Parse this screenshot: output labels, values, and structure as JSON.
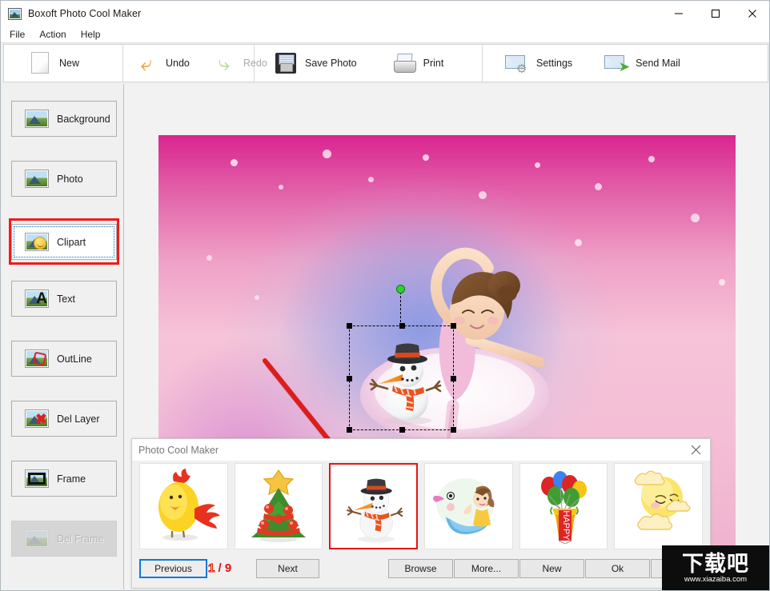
{
  "window": {
    "title": "Boxoft Photo Cool Maker",
    "icon": "app-photo-icon",
    "controls": {
      "minimize": "—",
      "maximize": "☐",
      "close": "✕"
    }
  },
  "menubar": {
    "items": [
      {
        "label": "File"
      },
      {
        "label": "Action"
      },
      {
        "label": "Help"
      }
    ]
  },
  "toolbar": {
    "groups": [
      {
        "buttons": [
          {
            "label": "New",
            "icon": "new-page-icon",
            "disabled": false
          }
        ]
      },
      {
        "buttons": [
          {
            "label": "Undo",
            "icon": "undo-arrow-icon",
            "disabled": false
          },
          {
            "label": "Redo",
            "icon": "redo-arrow-icon",
            "disabled": true
          }
        ]
      },
      {
        "buttons": [
          {
            "label": "Save Photo",
            "icon": "floppy-disk-icon",
            "disabled": false
          },
          {
            "label": "Print",
            "icon": "printer-icon",
            "disabled": false
          }
        ]
      },
      {
        "buttons": [
          {
            "label": "Settings",
            "icon": "envelope-gear-icon",
            "disabled": false
          },
          {
            "label": "Send Mail",
            "icon": "envelope-arrow-icon",
            "disabled": false
          }
        ]
      }
    ]
  },
  "sidebar": {
    "items": [
      {
        "label": "Background",
        "icon": "image-icon",
        "selected": false,
        "disabled": false
      },
      {
        "label": "Photo",
        "icon": "image-icon",
        "selected": false,
        "disabled": false
      },
      {
        "label": "Clipart",
        "icon": "image-smiley-icon",
        "selected": true,
        "disabled": false
      },
      {
        "label": "Text",
        "icon": "image-letter-a-icon",
        "selected": false,
        "disabled": false
      },
      {
        "label": "OutLine",
        "icon": "image-outline-icon",
        "selected": false,
        "disabled": false
      },
      {
        "label": "Del Layer",
        "icon": "image-delete-icon",
        "selected": false,
        "disabled": false
      },
      {
        "label": "Frame",
        "icon": "image-frame-icon",
        "selected": false,
        "disabled": false
      },
      {
        "label": "Del Frame",
        "icon": "image-del-frame-icon",
        "selected": false,
        "disabled": true
      }
    ]
  },
  "canvas": {
    "photo_description": "ballerina-winter-illustration",
    "selected_object": "snowman-clipart",
    "annotation": "red-arrow-pointing-to-dialog"
  },
  "dialog": {
    "title": "Photo Cool Maker",
    "close_label": "✕",
    "thumbnails": [
      {
        "name": "chicken-clipart",
        "selected": false
      },
      {
        "name": "christmas-tree-clipart",
        "selected": false
      },
      {
        "name": "snowman-clipart",
        "selected": true
      },
      {
        "name": "girl-on-bird-clipart",
        "selected": false
      },
      {
        "name": "happy-balloons-clipart",
        "selected": false
      },
      {
        "name": "sun-face-clouds-clipart",
        "selected": false
      }
    ],
    "balloon_banner_text": "HAPPY",
    "buttons": {
      "previous": "Previous",
      "next": "Next",
      "browse": "Browse",
      "more": "More...",
      "new": "New",
      "ok": "Ok"
    },
    "page_current": "1",
    "page_separator": "/",
    "page_total": "9"
  },
  "watermark": {
    "logo": "下载吧",
    "url": "www.xiazaiba.com"
  },
  "colors": {
    "accent_red": "#e81414",
    "focus_blue": "#0a7ad6",
    "page_number_yellow": "#ffe000",
    "toolbar_bg": "#ffffff",
    "panel_bg": "#f0f0f0"
  }
}
